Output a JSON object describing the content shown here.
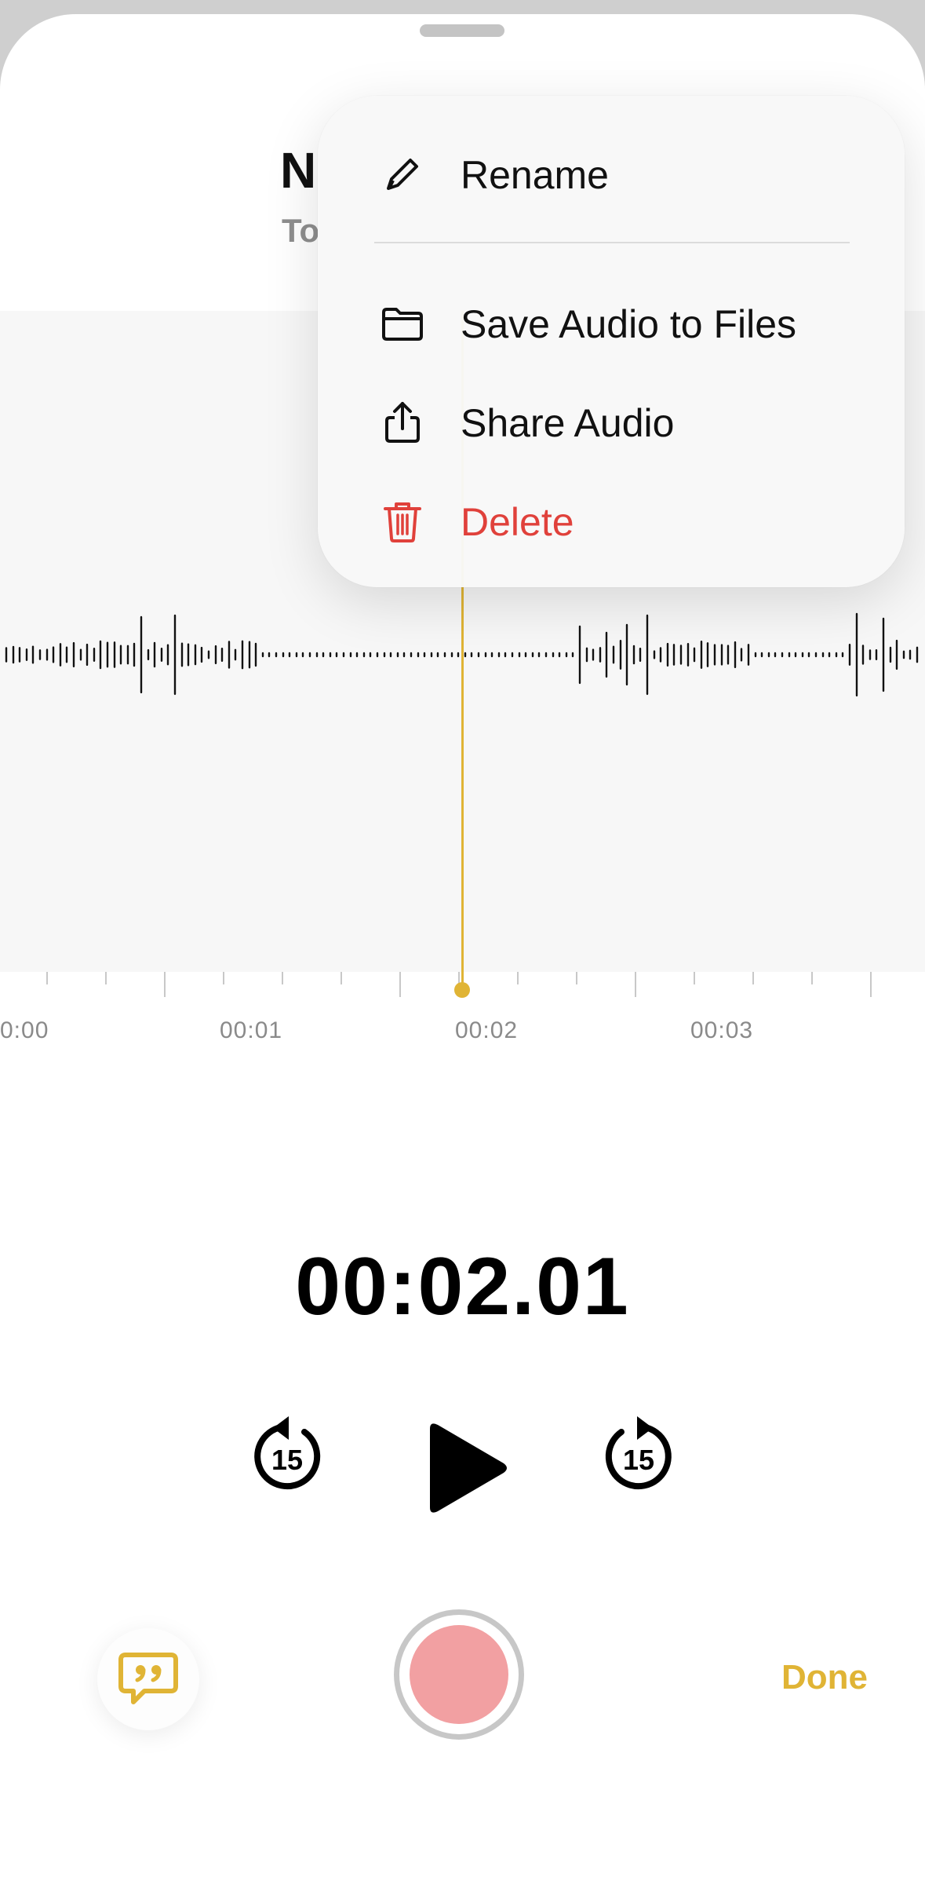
{
  "recording": {
    "title": "N",
    "subtitle": "To"
  },
  "timeline": {
    "labels": [
      "0:00",
      "00:01",
      "00:02",
      "00:03"
    ],
    "elapsed": "00:02.01"
  },
  "context_menu": {
    "items": [
      {
        "label": "Rename",
        "icon": "pencil-icon"
      },
      {
        "label": "Save Audio to Files",
        "icon": "folder-icon"
      },
      {
        "label": "Share Audio",
        "icon": "share-icon"
      },
      {
        "label": "Delete",
        "icon": "trash-icon",
        "destructive": true
      }
    ]
  },
  "controls": {
    "skip_back_seconds": "15",
    "skip_forward_seconds": "15",
    "done_label": "Done"
  },
  "colors": {
    "accent": "#e0b435",
    "destructive": "#e0413b",
    "record": "#f2a0a2"
  }
}
